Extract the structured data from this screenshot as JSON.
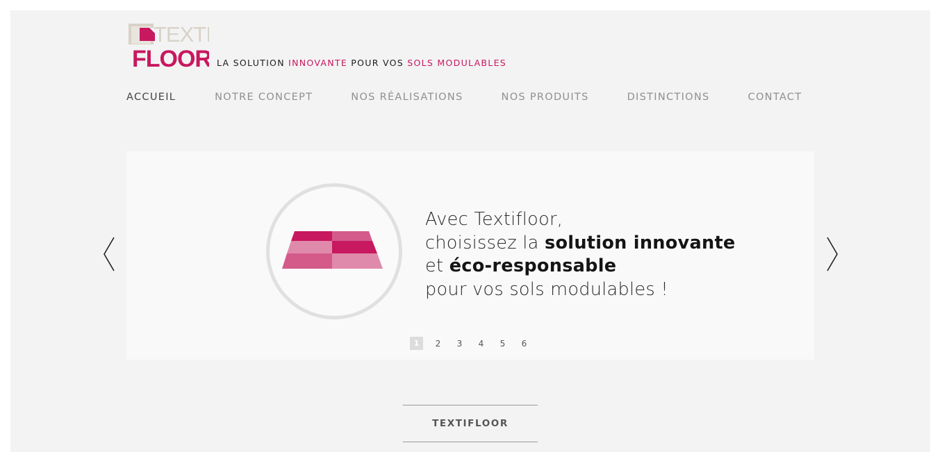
{
  "logo": {
    "word_top": "TEXTI",
    "word_bottom": "FLOOR"
  },
  "tagline": {
    "part1": "LA SOLUTION ",
    "highlight1": "INNOVANTE",
    "part2": " POUR VOS ",
    "highlight2": "SOLS MODULABLES"
  },
  "nav": {
    "items": [
      {
        "label": "ACCUEIL"
      },
      {
        "label": "NOTRE CONCEPT"
      },
      {
        "label": "NOS RÉALISATIONS"
      },
      {
        "label": "NOS PRODUITS"
      },
      {
        "label": "DISTINCTIONS"
      },
      {
        "label": "CONTACT"
      }
    ]
  },
  "slide": {
    "line1": "Avec Textifloor,",
    "line2_plain": "choisissez la ",
    "line2_bold": "solution innovante",
    "line3_plain": "et ",
    "line3_bold": "éco-responsable",
    "line4": "pour vos sols modulables !"
  },
  "pager": {
    "pages": [
      "1",
      "2",
      "3",
      "4",
      "5",
      "6"
    ],
    "current": "1"
  },
  "section": {
    "title": "TEXTIFLOOR"
  },
  "colors": {
    "brand_pink": "#c8185f",
    "page_bg": "#f3f3f3",
    "slider_bg": "#f9f9f9",
    "logo_beige": "#d8d2c8"
  },
  "icons": {
    "prev": "chevron-left-icon",
    "next": "chevron-right-icon",
    "tiles": "modular-tiles-icon"
  }
}
